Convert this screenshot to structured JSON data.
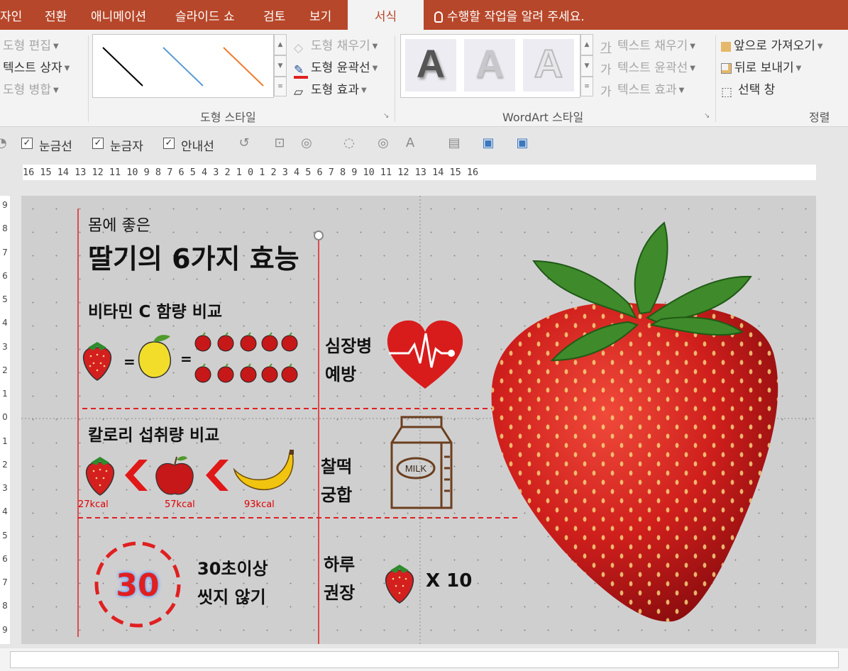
{
  "menu": {
    "tabs": [
      "자인",
      "전환",
      "애니메이션",
      "슬라이드 쇼",
      "검토",
      "보기",
      "서식"
    ],
    "active_tab": "서식",
    "tell_me": "수행할 작업을 알려 주세요."
  },
  "ribbon": {
    "insert_shapes": {
      "edit_shape": "도형 편집",
      "text_box": "텍스트 상자",
      "merge_shapes": "도형 병합"
    },
    "shape_styles": {
      "label": "도형 스타일",
      "fill": "도형 채우기",
      "outline": "도형 윤곽선",
      "effects": "도형 효과",
      "line_colors": [
        "#000000",
        "#5b9bd5",
        "#ed7d31"
      ]
    },
    "wordart_styles": {
      "label": "WordArt 스타일",
      "sample_letter": "A",
      "text_fill": "텍스트 채우기",
      "text_outline": "텍스트 윤곽선",
      "text_effects": "텍스트 효과"
    },
    "arrange": {
      "label": "정렬",
      "bring_forward": "앞으로 가져오기",
      "send_backward": "뒤로 보내기",
      "selection_pane": "선택 창"
    }
  },
  "viewbar": {
    "gridlines": "눈금선",
    "ruler": "눈금자",
    "guides": "안내선"
  },
  "ruler": {
    "horizontal": "16 15 14 13 12 11 10 9 8 7 6 5 4 3 2 1 0 1 2 3 4 5 6 7 8 9 10 11 12 13 14 15 16",
    "vertical": [
      "9",
      "8",
      "7",
      "6",
      "5",
      "4",
      "3",
      "2",
      "1",
      "0",
      "1",
      "2",
      "3",
      "4",
      "5",
      "6",
      "7",
      "8",
      "9"
    ]
  },
  "slide": {
    "subtitle": "몸에 좋은",
    "title": "딸기의 6가지 효능",
    "vitamin_heading": "비타민 C 함량 비교",
    "equals": "=",
    "heart_label_1": "심장병",
    "heart_label_2": "예방",
    "calorie_heading": "칼로리 섭취량 비교",
    "kcal_strawberry": "27kcal",
    "kcal_apple": "57kcal",
    "kcal_banana": "93kcal",
    "milk_label_1": "찰떡",
    "milk_label_2": "궁합",
    "milk_text": "MILK",
    "wash_number": "30",
    "wash_line_1": "30초이상",
    "wash_line_2": "씻지 않기",
    "daily_line_1": "하루",
    "daily_line_2": "권장",
    "daily_count": "X 10"
  },
  "colors": {
    "accent": "#b7472a",
    "divider_red": "#e02020",
    "strawberry_red": "#d41f1f"
  }
}
